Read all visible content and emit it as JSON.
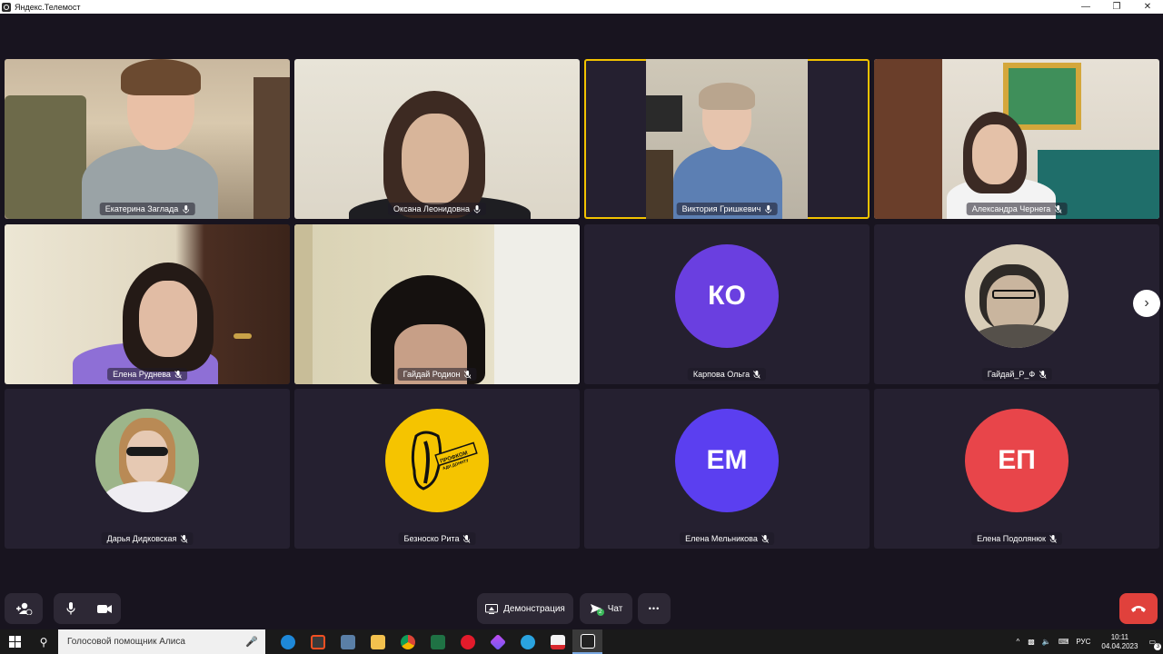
{
  "window": {
    "title": "Яндекс.Телемост"
  },
  "participants": [
    {
      "name": "Екатерина Заглада",
      "mic": "on"
    },
    {
      "name": "Оксана Леонидовна",
      "mic": "on"
    },
    {
      "name": "Виктория Гришкевич",
      "mic": "on"
    },
    {
      "name": "Александра Чернега",
      "mic": "off"
    },
    {
      "name": "Елена Руднева",
      "mic": "off"
    },
    {
      "name": "Гайдай Родион",
      "mic": "off"
    },
    {
      "name": "Карпова Ольга",
      "mic": "off",
      "initials": "КО",
      "color": "#6a3fe0"
    },
    {
      "name": "Гайдай_Р_Ф",
      "mic": "off"
    },
    {
      "name": "Дарья Дидковская",
      "mic": "off"
    },
    {
      "name": "Безноско Рита",
      "mic": "off",
      "logo_text": "ПРОФКОМ АДИ ДОННТУ",
      "logo_color": "#f5c400"
    },
    {
      "name": "Елена Мельникова",
      "mic": "off",
      "initials": "ЕМ",
      "color": "#5b3ff0"
    },
    {
      "name": "Елена Подолянюк",
      "mic": "off",
      "initials": "ЕП",
      "color": "#e8454a"
    }
  ],
  "controls": {
    "demo_label": "Демонстрация",
    "chat_label": "Чат",
    "chat_badge": "2",
    "more_label": "•••"
  },
  "taskbar": {
    "search_placeholder": "Голосовой помощник Алиса",
    "lang": "РУС",
    "time": "10:11",
    "date": "04.04.2023",
    "notifications": "3"
  },
  "colors": {
    "active_speaker": "#f2c200",
    "end_call": "#e0413c",
    "background": "#18141f"
  }
}
